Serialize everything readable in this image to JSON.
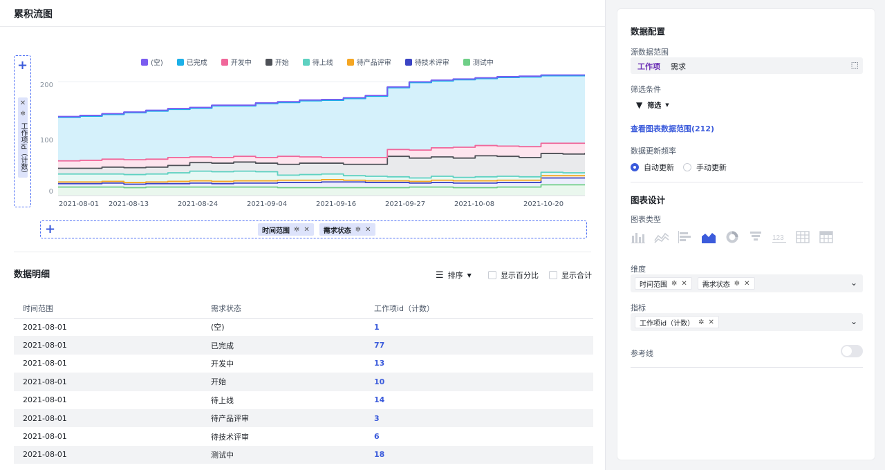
{
  "page": {
    "title": "累积流图"
  },
  "chart_data": {
    "type": "area",
    "stacked": true,
    "ylim": [
      0,
      215
    ],
    "yticks": [
      "200",
      "100",
      "0"
    ],
    "xticks": [
      "2021-08-01",
      "2021-08-13",
      "2021-08-24",
      "2021-09-04",
      "2021-09-16",
      "2021-09-27",
      "2021-10-08",
      "2021-10-20"
    ],
    "x_dates": [
      "08-01",
      "08-04",
      "08-08",
      "08-11",
      "08-15",
      "08-18",
      "08-22",
      "08-26",
      "08-30",
      "09-02",
      "09-06",
      "09-09",
      "09-13",
      "09-16",
      "09-20",
      "09-23",
      "09-27",
      "10-01",
      "10-04",
      "10-08",
      "10-11",
      "10-15",
      "10-19",
      "10-22",
      "10-26"
    ],
    "series": [
      {
        "name": "测试中",
        "color": "#6fcf87",
        "fill": "#eaf7ee",
        "values": [
          15,
          15,
          15,
          14,
          15,
          15,
          15,
          15,
          15,
          15,
          14,
          14,
          14,
          14,
          14,
          14,
          15,
          15,
          14,
          14,
          15,
          15,
          19,
          19,
          19
        ]
      },
      {
        "name": "待技术评审",
        "color": "#3b44c4",
        "fill": "#eceefc",
        "values": [
          6,
          6,
          7,
          6,
          6,
          6,
          7,
          6,
          7,
          7,
          9,
          9,
          10,
          10,
          9,
          9,
          7,
          8,
          8,
          8,
          8,
          8,
          12,
          12,
          12
        ]
      },
      {
        "name": "待产品评审",
        "color": "#f5a623",
        "fill": "#fdf4e4",
        "values": [
          3,
          3,
          3,
          3,
          3,
          4,
          4,
          4,
          4,
          4,
          4,
          4,
          4,
          3,
          3,
          3,
          3,
          4,
          4,
          4,
          4,
          4,
          4,
          4,
          4
        ]
      },
      {
        "name": "待上线",
        "color": "#5ed1c1",
        "fill": "#e6f8f5",
        "values": [
          14,
          14,
          13,
          14,
          14,
          15,
          17,
          17,
          17,
          16,
          9,
          10,
          10,
          8,
          8,
          7,
          6,
          7,
          6,
          7,
          7,
          6,
          6,
          5,
          6
        ]
      },
      {
        "name": "开始",
        "color": "#4e5157",
        "fill": "#e9eaec",
        "values": [
          10,
          10,
          12,
          12,
          12,
          13,
          15,
          15,
          16,
          15,
          19,
          20,
          19,
          20,
          21,
          36,
          35,
          34,
          34,
          37,
          35,
          34,
          33,
          33,
          34
        ]
      },
      {
        "name": "开发中",
        "color": "#f0679a",
        "fill": "#fde5ee",
        "values": [
          13,
          14,
          14,
          14,
          14,
          14,
          10,
          10,
          10,
          10,
          14,
          11,
          10,
          12,
          12,
          12,
          14,
          16,
          19,
          18,
          18,
          19,
          18,
          19,
          18
        ]
      },
      {
        "name": "已完成",
        "color": "#1cb0e8",
        "fill": "#d5f1fb",
        "values": [
          77,
          78,
          79,
          83,
          85,
          85,
          86,
          91,
          89,
          95,
          95,
          99,
          101,
          104,
          108,
          109,
          119,
          118,
          119,
          118,
          121,
          123,
          119,
          119,
          119
        ]
      },
      {
        "name": "(空)",
        "color": "#7a5cf0",
        "fill": "#ece8fd",
        "values": [
          1,
          1,
          1,
          1,
          1,
          1,
          1,
          1,
          1,
          1,
          1,
          1,
          1,
          1,
          1,
          1,
          1,
          1,
          1,
          1,
          1,
          1,
          1,
          1,
          1
        ]
      }
    ],
    "legend": [
      "(空)",
      "已完成",
      "开发中",
      "开始",
      "待上线",
      "待产品评审",
      "待技术评审",
      "测试中"
    ],
    "legend_colors": [
      "#7a5cf0",
      "#1cb0e8",
      "#f0679a",
      "#4e5157",
      "#5ed1c1",
      "#f5a623",
      "#3b44c4",
      "#6fcf87"
    ],
    "legend_position": "top"
  },
  "y_axis_field": {
    "label": "工作项id（计数）"
  },
  "x_axis_fields": [
    {
      "label": "时间范围"
    },
    {
      "label": "需求状态"
    }
  ],
  "detail": {
    "title": "数据明细",
    "sort_label": "排序",
    "show_percent": "显示百分比",
    "show_total": "显示合计",
    "columns": [
      "时间范围",
      "需求状态",
      "工作项id（计数）"
    ],
    "rows": [
      [
        "2021-08-01",
        "(空)",
        "1"
      ],
      [
        "2021-08-01",
        "已完成",
        "77"
      ],
      [
        "2021-08-01",
        "开发中",
        "13"
      ],
      [
        "2021-08-01",
        "开始",
        "10"
      ],
      [
        "2021-08-01",
        "待上线",
        "14"
      ],
      [
        "2021-08-01",
        "待产品评审",
        "3"
      ],
      [
        "2021-08-01",
        "待技术评审",
        "6"
      ],
      [
        "2021-08-01",
        "测试中",
        "18"
      ]
    ]
  },
  "config": {
    "title": "数据配置",
    "source_label": "源数据范围",
    "source_tag": "工作项",
    "source_value": "需求",
    "filter_label": "筛选条件",
    "filter_button": "筛选",
    "view_range_link": "查看图表数据范围(212)",
    "freq_label": "数据更新频率",
    "freq_auto": "自动更新",
    "freq_manual": "手动更新",
    "accent": "#3b5bdb"
  },
  "design": {
    "title": "图表设计",
    "chart_type_label": "图表类型",
    "chart_types": [
      "bar-chart-icon",
      "line-chart-icon",
      "horizontal-bar-icon",
      "area-chart-icon",
      "donut-chart-icon",
      "funnel-chart-icon",
      "number-card-icon",
      "table-icon",
      "pivot-table-icon"
    ],
    "selected_chart_type": "area-chart-icon",
    "number_card_text": "123",
    "dimension_label": "维度",
    "dimensions": [
      "时间范围",
      "需求状态"
    ],
    "metric_label": "指标",
    "metrics": [
      "工作项id（计数）"
    ],
    "refline_label": "参考线",
    "refline_on": false
  }
}
